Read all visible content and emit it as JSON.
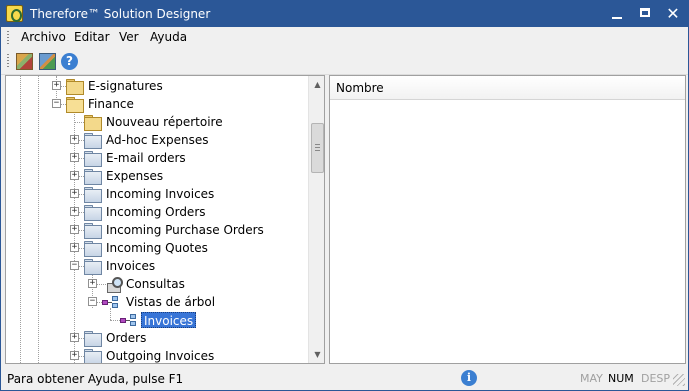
{
  "window": {
    "title": "Therefore™ Solution Designer",
    "controls": {
      "minimize": "—",
      "close": "✕"
    }
  },
  "menubar": {
    "items": [
      "Archivo",
      "Editar",
      "Ver",
      "Ayuda"
    ]
  },
  "toolbar": {
    "help_glyph": "?"
  },
  "tree": {
    "nodes": [
      {
        "label": "E-signatures",
        "expander": "+",
        "icon": "folder"
      },
      {
        "label": "Finance",
        "expander": "−",
        "icon": "folder-open"
      },
      {
        "label": "Nouveau répertoire",
        "expander": "",
        "icon": "folder"
      },
      {
        "label": "Ad-hoc Expenses",
        "expander": "+",
        "icon": "category-folder"
      },
      {
        "label": "E-mail orders",
        "expander": "+",
        "icon": "category-folder"
      },
      {
        "label": "Expenses",
        "expander": "+",
        "icon": "category-folder"
      },
      {
        "label": "Incoming Invoices",
        "expander": "+",
        "icon": "category-folder"
      },
      {
        "label": "Incoming Orders",
        "expander": "+",
        "icon": "category-folder"
      },
      {
        "label": "Incoming Purchase Orders",
        "expander": "+",
        "icon": "category-folder"
      },
      {
        "label": "Incoming Quotes",
        "expander": "+",
        "icon": "category-folder"
      },
      {
        "label": "Invoices",
        "expander": "−",
        "icon": "category-folder"
      },
      {
        "label": "Consultas",
        "expander": "+",
        "icon": "query"
      },
      {
        "label": "Vistas de árbol",
        "expander": "−",
        "icon": "tree-view"
      },
      {
        "label": "Invoices",
        "expander": "",
        "icon": "tree-view",
        "selected": true
      },
      {
        "label": "Orders",
        "expander": "+",
        "icon": "category-folder"
      },
      {
        "label": "Outgoing Invoices",
        "expander": "+",
        "icon": "category-folder"
      }
    ]
  },
  "list": {
    "column_header": "Nombre"
  },
  "statusbar": {
    "text": "Para obtener Ayuda, pulse F1",
    "info_glyph": "i",
    "indicators": [
      {
        "label": "MAY",
        "active": false
      },
      {
        "label": "NUM",
        "active": true
      },
      {
        "label": "DESP",
        "active": false
      }
    ]
  },
  "colors": {
    "titlebar": "#2b5797",
    "selection": "#3875d7"
  }
}
